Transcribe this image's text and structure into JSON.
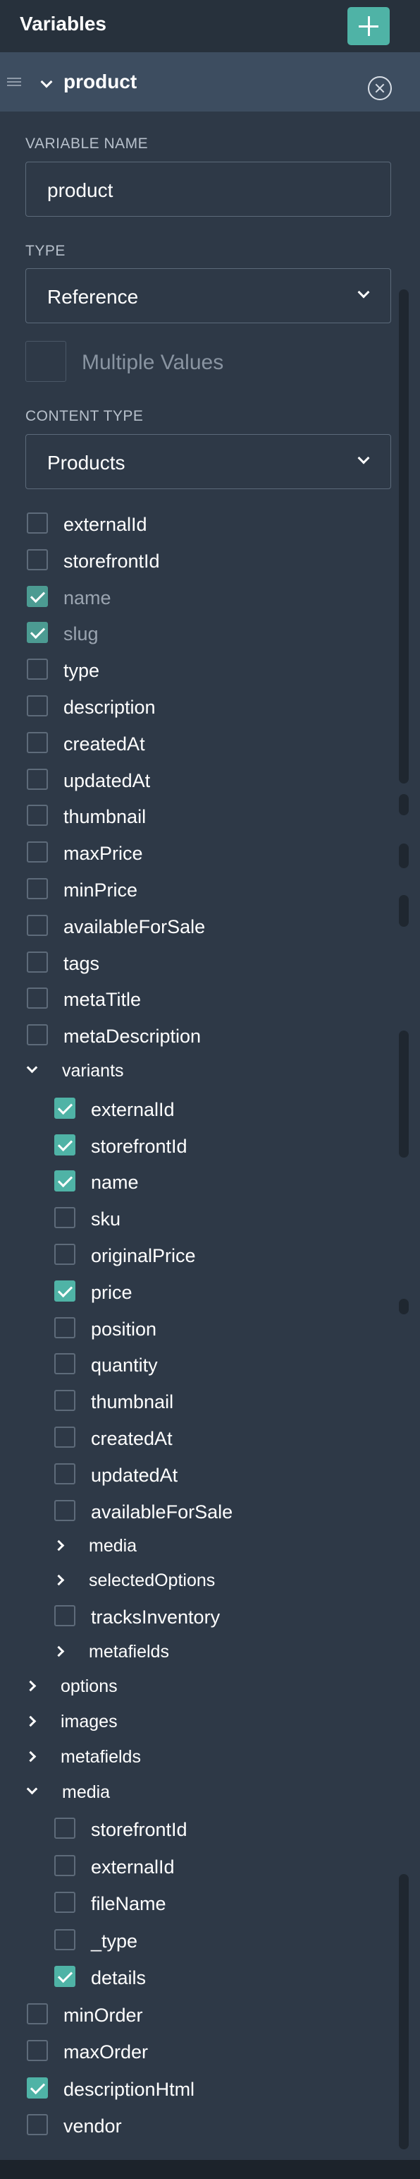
{
  "header": {
    "title": "Variables"
  },
  "variable": {
    "name": "product"
  },
  "form": {
    "variable_name_label": "VARIABLE NAME",
    "variable_name_value": "product",
    "type_label": "TYPE",
    "type_value": "Reference",
    "multiple_values_label": "Multiple Values",
    "content_type_label": "CONTENT TYPE",
    "content_type_value": "Products"
  },
  "fields": [
    {
      "label": "externalId",
      "checked": false
    },
    {
      "label": "storefrontId",
      "checked": false
    },
    {
      "label": "name",
      "checked": true,
      "disabled": true
    },
    {
      "label": "slug",
      "checked": true,
      "disabled": true
    },
    {
      "label": "type",
      "checked": false
    },
    {
      "label": "description",
      "checked": false
    },
    {
      "label": "createdAt",
      "checked": false
    },
    {
      "label": "updatedAt",
      "checked": false
    },
    {
      "label": "thumbnail",
      "checked": false
    },
    {
      "label": "maxPrice",
      "checked": false
    },
    {
      "label": "minPrice",
      "checked": false
    },
    {
      "label": "availableForSale",
      "checked": false
    },
    {
      "label": "tags",
      "checked": false
    },
    {
      "label": "metaTitle",
      "checked": false
    },
    {
      "label": "metaDescription",
      "checked": false
    }
  ],
  "variants": {
    "label": "variants",
    "fields": [
      {
        "label": "externalId",
        "checked": true
      },
      {
        "label": "storefrontId",
        "checked": true
      },
      {
        "label": "name",
        "checked": true
      },
      {
        "label": "sku",
        "checked": false
      },
      {
        "label": "originalPrice",
        "checked": false
      },
      {
        "label": "price",
        "checked": true
      },
      {
        "label": "position",
        "checked": false
      },
      {
        "label": "quantity",
        "checked": false
      },
      {
        "label": "thumbnail",
        "checked": false
      },
      {
        "label": "createdAt",
        "checked": false
      },
      {
        "label": "updatedAt",
        "checked": false
      },
      {
        "label": "availableForSale",
        "checked": false
      }
    ],
    "groups_a": [
      "media",
      "selectedOptions"
    ],
    "tracks_inventory": {
      "label": "tracksInventory",
      "checked": false
    },
    "groups_b": [
      "metafields"
    ]
  },
  "collapsed_groups": [
    "options",
    "images",
    "metafields"
  ],
  "media": {
    "label": "media",
    "fields": [
      {
        "label": "storefrontId",
        "checked": false
      },
      {
        "label": "externalId",
        "checked": false
      },
      {
        "label": "fileName",
        "checked": false
      },
      {
        "label": "_type",
        "checked": false
      },
      {
        "label": "details",
        "checked": true
      }
    ]
  },
  "tail_fields": [
    {
      "label": "minOrder",
      "checked": false
    },
    {
      "label": "maxOrder",
      "checked": false
    },
    {
      "label": "descriptionHtml",
      "checked": true
    },
    {
      "label": "vendor",
      "checked": false
    }
  ],
  "colors": {
    "accent": "#4fb3a6",
    "background": "#2e3947",
    "header": "#3d4d60"
  }
}
